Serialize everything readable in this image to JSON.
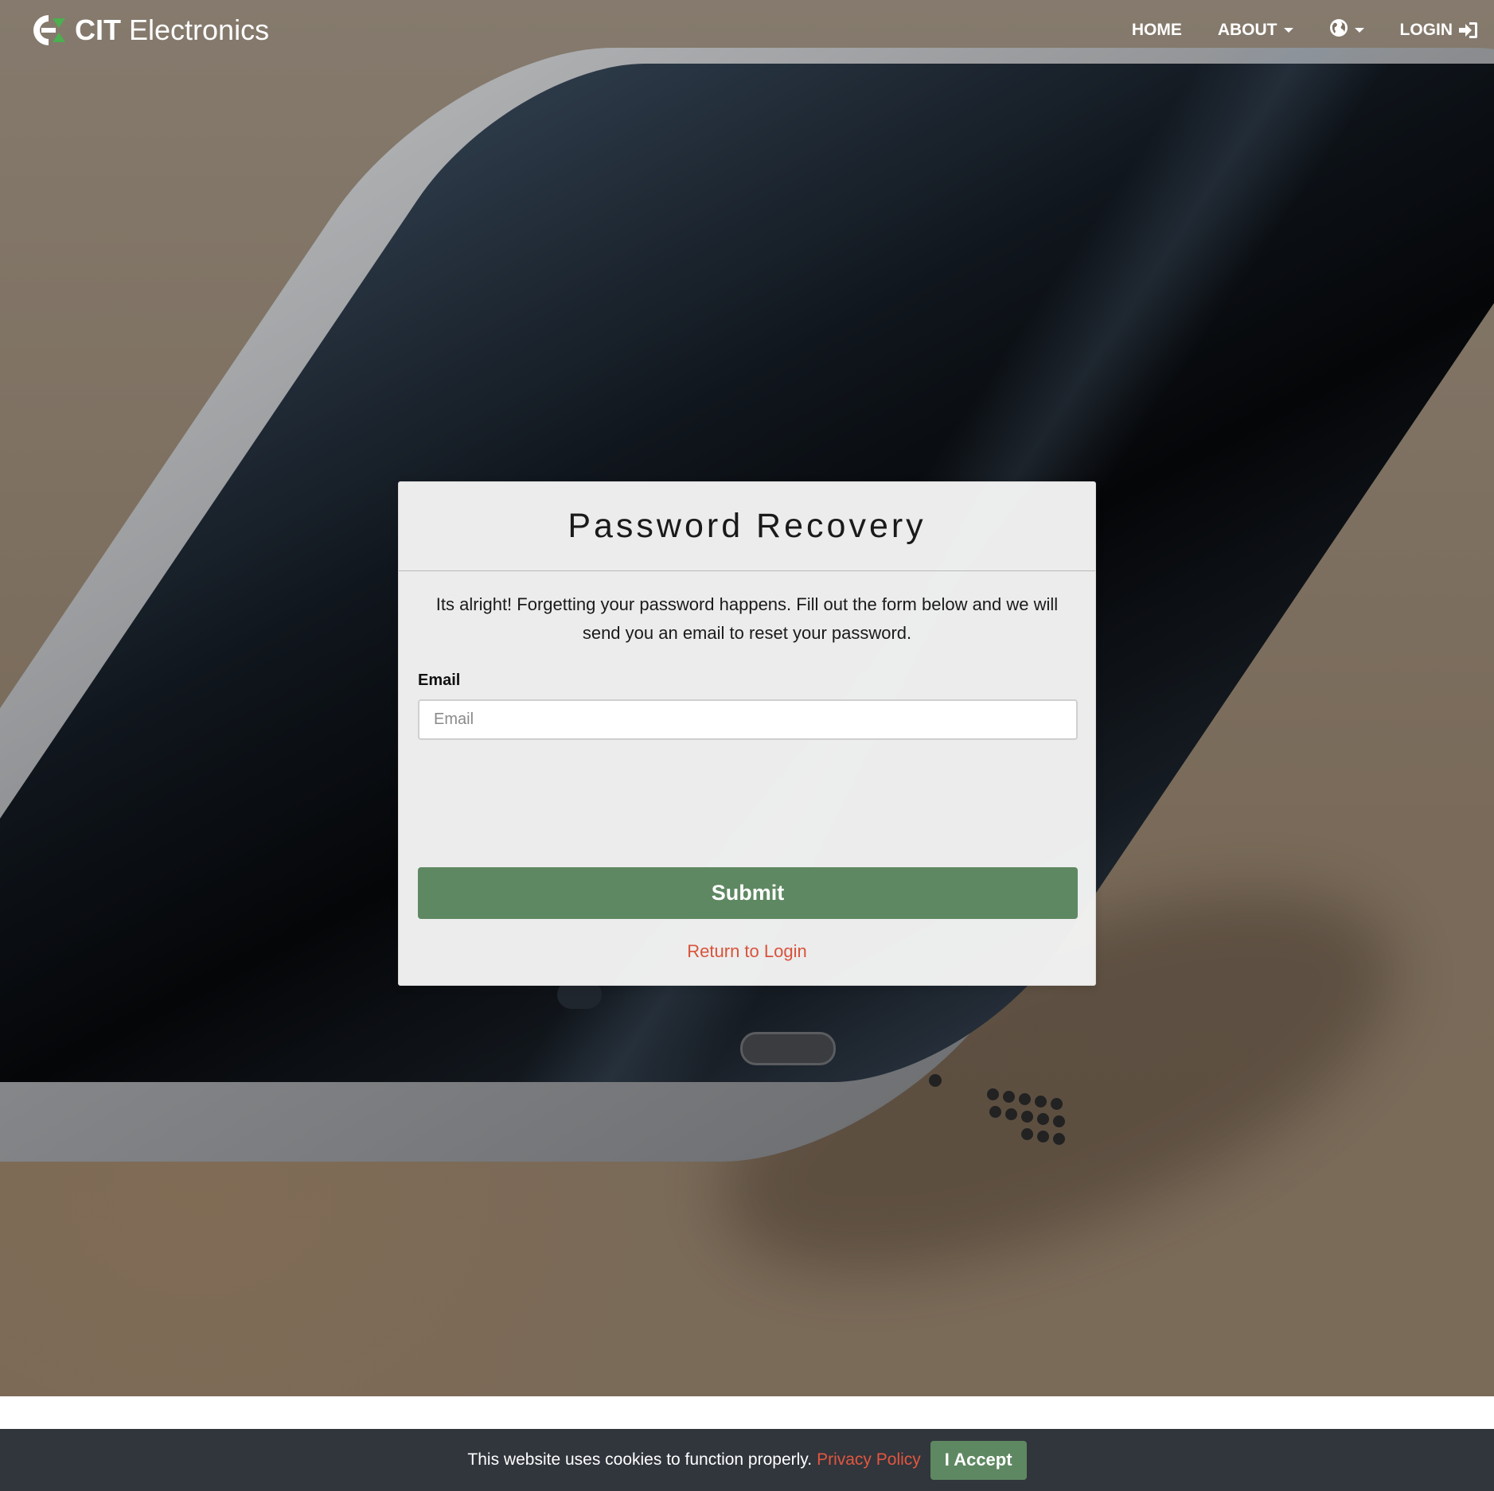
{
  "navbar": {
    "brand_bold": "CIT",
    "brand_light": "Electronics",
    "home_label": "HOME",
    "about_label": "ABOUT",
    "login_label": "LOGIN",
    "logo_icon": "cit-logo",
    "language_icon": "globe-icon",
    "login_icon": "sign-in-icon"
  },
  "card": {
    "title": "Password Recovery",
    "intro": "Its alright! Forgetting your password happens. Fill out the form below and we will send you an email to reset your password.",
    "email_label": "Email",
    "email_placeholder": "Email",
    "email_value": "",
    "submit_label": "Submit",
    "return_link": "Return to Login"
  },
  "cookie_bar": {
    "message": "This website uses cookies to function properly.",
    "privacy_link": "Privacy Policy",
    "accept_label": "I Accept"
  },
  "colors": {
    "accent_green": "#5e8861",
    "link_red": "#d9533b",
    "cookie_bg": "#31353c"
  }
}
